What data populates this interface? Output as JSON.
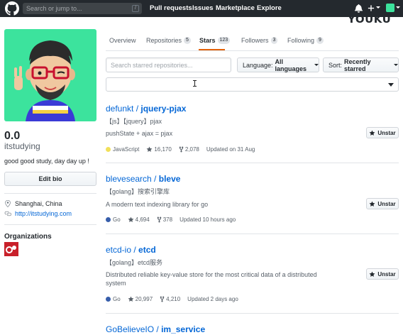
{
  "header": {
    "search_placeholder": "Search or jump to...",
    "slash_key": "/",
    "nav": [
      "Pull requests",
      "Issues",
      "Marketplace",
      "Explore"
    ],
    "icons": [
      "github-logo-icon",
      "bell-icon",
      "plus-icon",
      "avatar-icon"
    ],
    "watermark": "YOUKU",
    "colors": {
      "background": "#24292e"
    }
  },
  "profile": {
    "count": "0.0",
    "login": "itstudying",
    "bio": "good good study, day day up !",
    "edit_bio_label": "Edit bio",
    "location": "Shanghai, China",
    "website": "http://itstudying.com",
    "organizations_title": "Organizations",
    "avatar_color": "#3ce39d"
  },
  "tabs": [
    {
      "label": "Overview",
      "count": ""
    },
    {
      "label": "Repositories",
      "count": "5"
    },
    {
      "label": "Stars",
      "count": "123",
      "selected": true
    },
    {
      "label": "Followers",
      "count": "3"
    },
    {
      "label": "Following",
      "count": "9"
    }
  ],
  "filters": {
    "search_placeholder": "Search starred repositories...",
    "language_label": "Language:",
    "language_value": "All languages",
    "sort_label": "Sort:",
    "sort_value": "Recently starred"
  },
  "repos": [
    {
      "owner": "defunkt",
      "sep": " / ",
      "name": "jquery-pjax",
      "desc": [
        "【js】【jquery】pjax",
        "pushState + ajax = pjax"
      ],
      "language": "JavaScript",
      "language_color": "#f1e05a",
      "stars": "16,170",
      "forks": "2,078",
      "updated": "Updated on 31 Aug",
      "unstar_label": "Unstar"
    },
    {
      "owner": "blevesearch",
      "sep": " / ",
      "name": "bleve",
      "desc": [
        "【golang】搜索引擎库",
        "A modern text indexing library for go"
      ],
      "language": "Go",
      "language_color": "#375eab",
      "stars": "4,694",
      "forks": "378",
      "updated": "Updated 10 hours ago",
      "unstar_label": "Unstar"
    },
    {
      "owner": "etcd-io",
      "sep": " / ",
      "name": "etcd",
      "desc": [
        "【golang】etcd服务",
        "Distributed reliable key-value store for the most critical data of a distributed",
        "system"
      ],
      "language": "Go",
      "language_color": "#375eab",
      "stars": "20,997",
      "forks": "4,210",
      "updated": "Updated 2 days ago",
      "unstar_label": "Unstar"
    },
    {
      "owner": "GoBelieveIO",
      "sep": " / ",
      "name": "im_service"
    }
  ]
}
